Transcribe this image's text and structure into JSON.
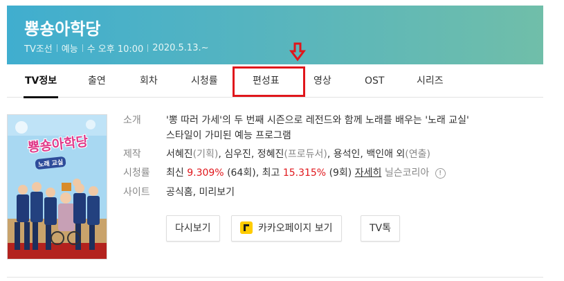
{
  "header": {
    "title": "뿅숑아학당",
    "channel": "TV조선",
    "genre": "예능",
    "schedule": "수 오후 10:00",
    "start_date": "2020.5.13.~",
    "background_colors": [
      "#40aecf",
      "#70bea9"
    ]
  },
  "tabs": [
    {
      "label": "TV정보",
      "active": true
    },
    {
      "label": "출연",
      "active": false
    },
    {
      "label": "회차",
      "active": false
    },
    {
      "label": "시청률",
      "active": false
    },
    {
      "label": "편성표",
      "active": false,
      "highlighted": true
    },
    {
      "label": "영상",
      "active": false
    },
    {
      "label": "OST",
      "active": false
    },
    {
      "label": "시리즈",
      "active": false
    }
  ],
  "poster": {
    "title_text": "뿅숑아학당",
    "subtitle_text": "노래 교실"
  },
  "info": {
    "intro_label": "소개",
    "intro_line1": "'뽕 따러 가세'의 두 번째 시즌으로 레전드와 함께 노래를 배우는 '노래 교실'",
    "intro_line2": "스타일이 가미된 예능 프로그램",
    "production_label": "제작",
    "production_planning": "서혜진",
    "production_planning_role": "(기획)",
    "production_producers": "심우진, 정혜진",
    "production_producers_role": "(프로듀서)",
    "production_directors": "용석인, 백인애 외",
    "production_directors_role": "(연출)",
    "rating_label": "시청률",
    "rating_latest_prefix": "최신",
    "rating_latest_value": "9.309%",
    "rating_latest_episode": "(64회)",
    "rating_max_prefix": "최고",
    "rating_max_value": "15.315%",
    "rating_max_episode": "(9회)",
    "rating_source_link": "자세히",
    "rating_source": "닐슨코리아",
    "info_icon_glyph": "!",
    "site_label": "사이트",
    "site_official": "공식홈",
    "site_preview": "미리보기"
  },
  "buttons": {
    "replay": "다시보기",
    "kakao_page": "카카오페이지 보기",
    "tv_talk": "TV톡"
  },
  "colors": {
    "accent_red": "#e0161b",
    "kakao_yellow": "#ffcc00"
  }
}
